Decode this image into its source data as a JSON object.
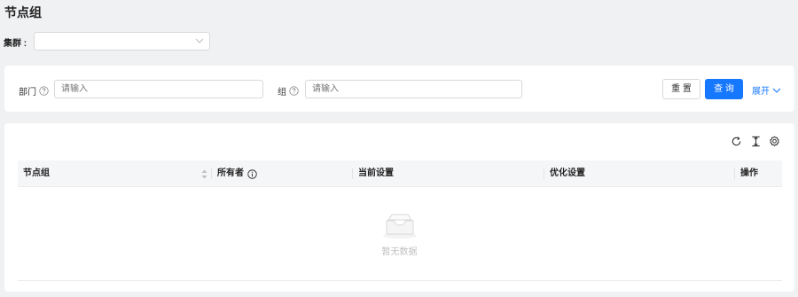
{
  "page": {
    "title": "节点组"
  },
  "cluster": {
    "label": "集群 :",
    "value": ""
  },
  "search": {
    "department": {
      "label": "部门",
      "placeholder": "请输入"
    },
    "group": {
      "label": "组",
      "placeholder": "请输入"
    },
    "reset_label": "重 置",
    "query_label": "查 询",
    "expand_label": "展开"
  },
  "toolbar": {
    "icons": [
      "refresh-icon",
      "column-height-icon",
      "settings-icon"
    ]
  },
  "table": {
    "columns": [
      {
        "label": "节点组",
        "sortable": true
      },
      {
        "label": "所有者",
        "help": true
      },
      {
        "label": "当前设置"
      },
      {
        "label": "优化设置"
      },
      {
        "label": "操作"
      }
    ],
    "rows": [],
    "empty_text": "暂无数据"
  },
  "colors": {
    "primary": "#1677ff",
    "background": "#f0f1f3",
    "border": "#d9d9d9",
    "placeholder": "#bfbfbf"
  }
}
